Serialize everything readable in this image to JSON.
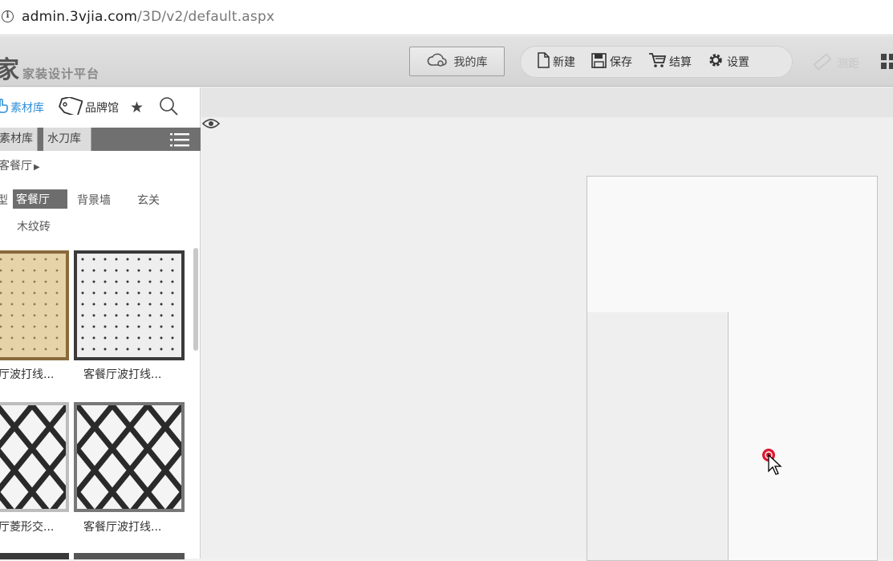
{
  "browser": {
    "url_host": "admin.3vjia.com",
    "url_path": "/3D/v2/default.aspx"
  },
  "app": {
    "logo_glyph": "家",
    "subtitle": "家装设计平台"
  },
  "toolbar": {
    "my_library": "我的库",
    "new": "新建",
    "save": "保存",
    "checkout": "结算",
    "settings": "设置",
    "measure": "测距"
  },
  "sidebar": {
    "tabs": {
      "materials": "素材库",
      "brands": "品牌馆"
    },
    "libs": {
      "material": "素材库",
      "water": "水刀库"
    },
    "breadcrumb": "客餐厅",
    "categories": {
      "partial": "型",
      "selected": "客餐厅",
      "background": "背景墙",
      "entrance": "玄关",
      "wood": "木纹砖"
    },
    "items": [
      {
        "label": "厅波打线..."
      },
      {
        "label": "客餐厅波打线..."
      },
      {
        "label": "厅菱形交..."
      },
      {
        "label": "客餐厅波打线..."
      }
    ]
  },
  "colors": {
    "accent": "#2f8fd8",
    "cursor_ring": "#d9001b"
  }
}
